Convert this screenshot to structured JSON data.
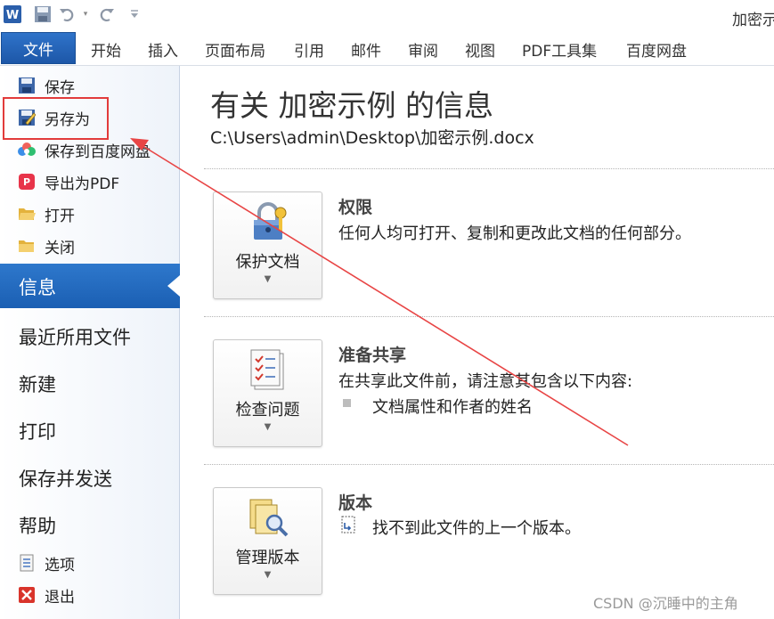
{
  "window": {
    "title": "加密示"
  },
  "ribbon": {
    "file_tab": "文件",
    "tabs": [
      "开始",
      "插入",
      "页面布局",
      "引用",
      "邮件",
      "审阅",
      "视图",
      "PDF工具集",
      "百度网盘"
    ]
  },
  "backstage": {
    "commands": [
      {
        "label": "保存",
        "icon": "save-icon"
      },
      {
        "label": "另存为",
        "icon": "save-as-icon"
      },
      {
        "label": "保存到百度网盘",
        "icon": "baidu-cloud-icon"
      },
      {
        "label": "导出为PDF",
        "icon": "pdf-icon"
      },
      {
        "label": "打开",
        "icon": "open-folder-icon"
      },
      {
        "label": "关闭",
        "icon": "close-folder-icon"
      }
    ],
    "tabs": [
      "信息",
      "最近所用文件",
      "新建",
      "打印",
      "保存并发送",
      "帮助"
    ],
    "footer": [
      {
        "label": "选项",
        "icon": "options-icon"
      },
      {
        "label": "退出",
        "icon": "exit-icon"
      }
    ]
  },
  "info": {
    "title": "有关 加密示例 的信息",
    "path": "C:\\Users\\admin\\Desktop\\加密示例.docx",
    "sections": [
      {
        "button": "保护文档",
        "button_icon": "lock-key-icon",
        "title": "权限",
        "description": "任何人均可打开、复制和更改此文档的任何部分。"
      },
      {
        "button": "检查问题",
        "button_icon": "checklist-icon",
        "title": "准备共享",
        "description": "在共享此文件前，请注意其包含以下内容:",
        "bullets": [
          "文档属性和作者的姓名"
        ]
      },
      {
        "button": "管理版本",
        "button_icon": "manage-versions-icon",
        "title": "版本",
        "description": "找不到此文件的上一个版本。"
      }
    ]
  },
  "watermark": "CSDN @沉睡中的主角",
  "colors": {
    "accent": "#1d5fb3",
    "highlight": "#e23b3b"
  }
}
